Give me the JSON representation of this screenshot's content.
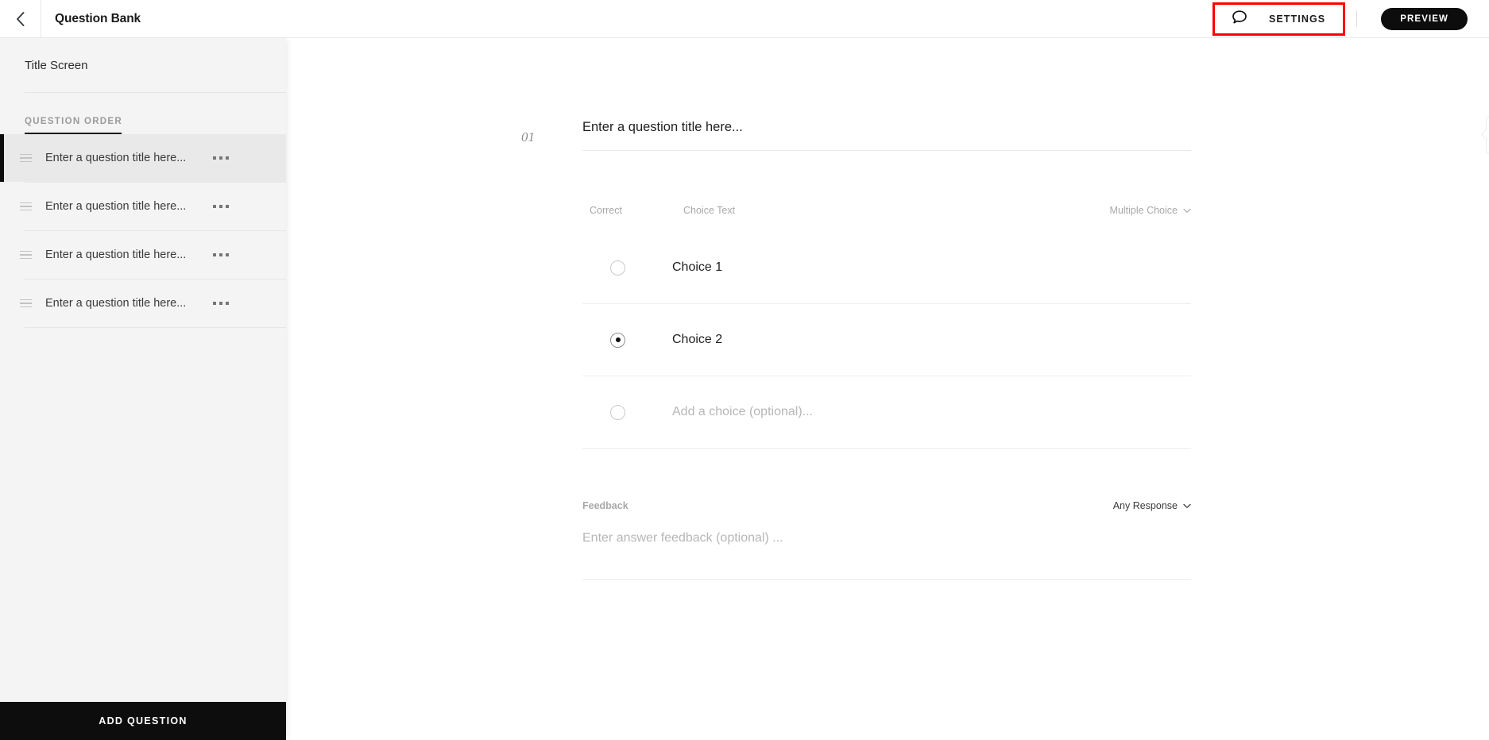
{
  "topbar": {
    "back_icon": "chevron-left-icon",
    "doc_title": "Question Bank",
    "settings_icon": "speech-bubble-icon",
    "settings_label": "SETTINGS",
    "preview_label": "PREVIEW",
    "highlight_color": "#ff0000"
  },
  "sidebar": {
    "title_screen_label": "Title Screen",
    "section_label": "QUESTION ORDER",
    "questions": [
      {
        "label": "Enter a question title here...",
        "selected": true
      },
      {
        "label": "Enter a question title here...",
        "selected": false
      },
      {
        "label": "Enter a question title here...",
        "selected": false
      },
      {
        "label": "Enter a question title here...",
        "selected": false
      }
    ],
    "drag_icon": "drag-handle-icon",
    "more_icon": "more-options-icon",
    "add_question_label": "ADD QUESTION"
  },
  "main": {
    "question_number": "01",
    "question_title_placeholder": "Enter a question title here...",
    "question_title_value": "",
    "add_image_icon": "camera-plus-icon",
    "columns": {
      "correct": "Correct",
      "choice_text": "Choice Text"
    },
    "question_type": "Multiple Choice",
    "choices": [
      {
        "text": "Choice 1",
        "selected": false,
        "placeholder": false
      },
      {
        "text": "Choice 2",
        "selected": true,
        "placeholder": false
      },
      {
        "text": "Add a choice (optional)...",
        "selected": false,
        "placeholder": true
      }
    ],
    "feedback": {
      "label": "Feedback",
      "response_scope": "Any Response",
      "placeholder": "Enter answer feedback (optional) ...",
      "value": ""
    }
  }
}
